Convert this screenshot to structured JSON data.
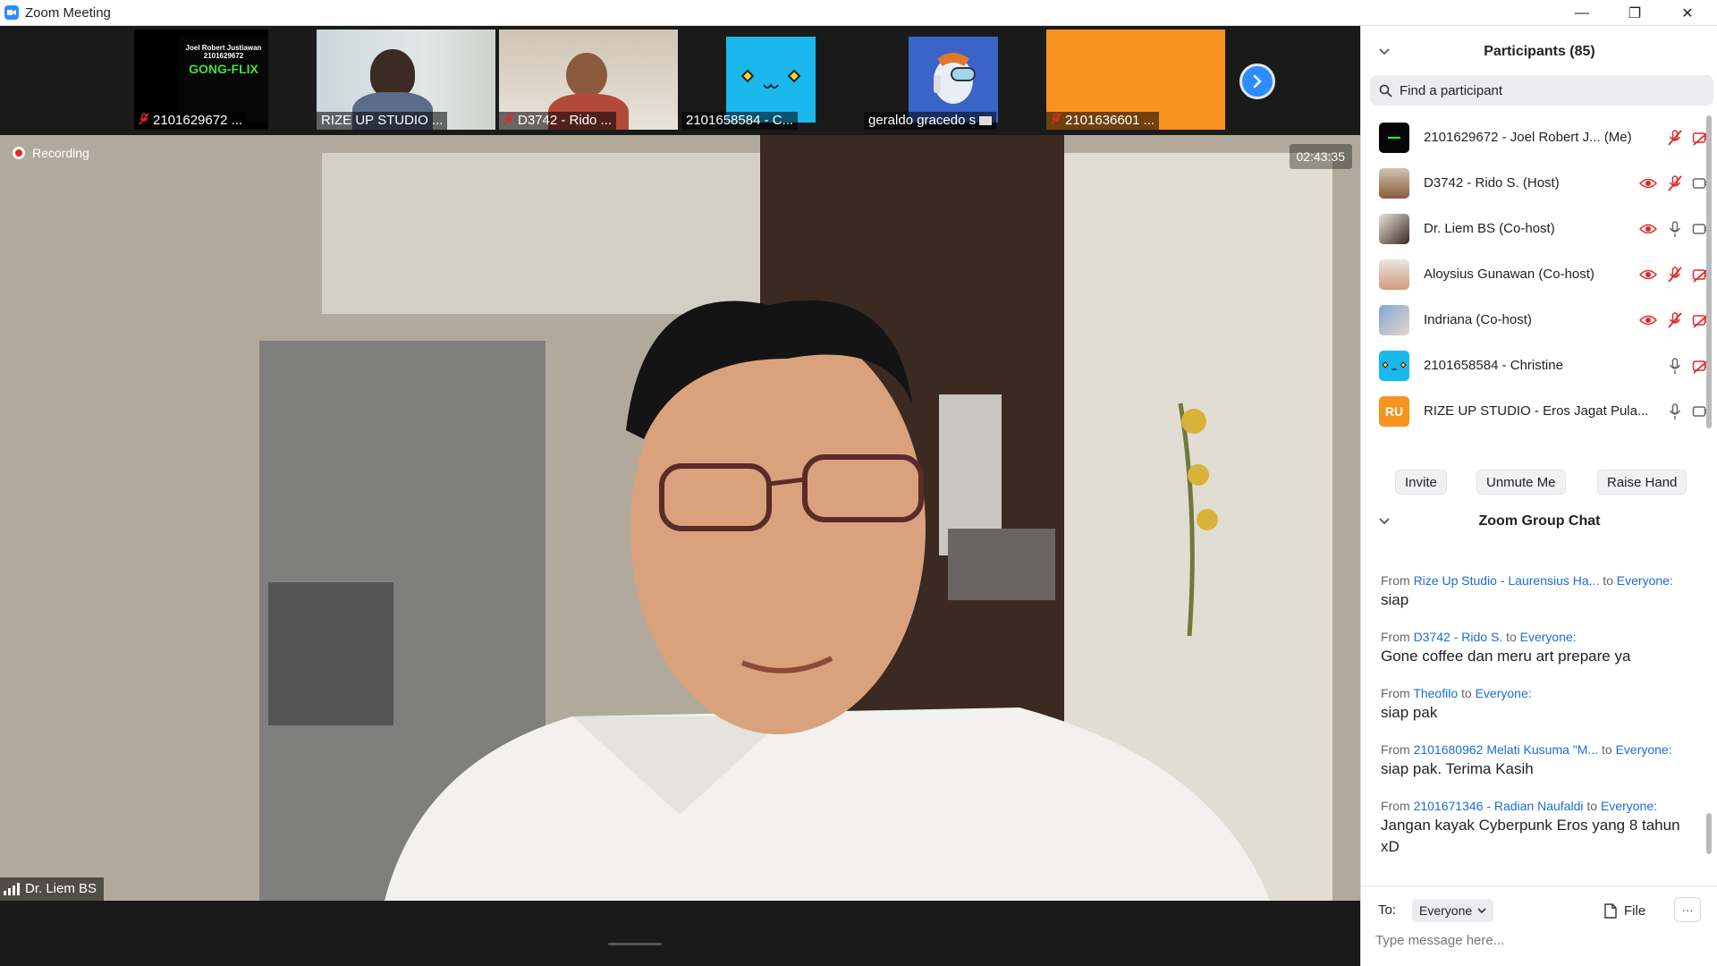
{
  "window": {
    "title": "Zoom Meeting",
    "minimize": "—",
    "restore": "❐",
    "close": "✕"
  },
  "thumbnails": [
    {
      "label": "2101629672 ...",
      "muted": true,
      "name_on_card": "Joel Robert Justiawan",
      "id_on_card": "2101629672",
      "brand_on_card": "GONG-FLIX"
    },
    {
      "label": "RIZE UP STUDIO ...",
      "muted": false
    },
    {
      "label": "D3742 - Rido ...",
      "muted": true
    },
    {
      "label": "2101658584 - C...",
      "muted": false
    },
    {
      "label": "geraldo gracedo s",
      "muted": false
    },
    {
      "label": "2101636601 ...",
      "muted": true
    }
  ],
  "main_video": {
    "recording_label": "Recording",
    "timer": "02:43:35",
    "speaker_name": "Dr. Liem BS"
  },
  "participants": {
    "header": "Participants (85)",
    "search_placeholder": "Find a participant",
    "list": [
      {
        "name": "2101629672 - Joel Robert J...",
        "suffix": "(Me)",
        "avatar": "image",
        "mic": "muted",
        "video": "off",
        "hand": false
      },
      {
        "name": "D3742 - Rido S. (Host)",
        "avatar": "image",
        "mic": "muted",
        "video": "on",
        "hand": true
      },
      {
        "name": "Dr. Liem BS (Co-host)",
        "avatar": "image",
        "mic": "on",
        "video": "on",
        "hand": true
      },
      {
        "name": "Aloysius Gunawan (Co-host)",
        "avatar": "image",
        "mic": "muted",
        "video": "off",
        "hand": true
      },
      {
        "name": "Indriana (Co-host)",
        "avatar": "image",
        "mic": "muted",
        "video": "off",
        "hand": true
      },
      {
        "name": "2101658584 - Christine",
        "avatar": "cat",
        "mic": "on",
        "video": "off",
        "hand": false
      },
      {
        "name": "RIZE UP STUDIO - Eros Jagat Pula...",
        "avatar": "initials",
        "initials": "RU",
        "mic": "on",
        "video": "on",
        "hand": false
      }
    ],
    "buttons": {
      "invite": "Invite",
      "unmute": "Unmute Me",
      "raise_hand": "Raise Hand"
    }
  },
  "chat": {
    "header": "Zoom Group Chat",
    "from_word": "From",
    "to_word": "to",
    "messages": [
      {
        "from": "Rize Up Studio - Laurensius Ha...",
        "to": "Everyone:",
        "text": "siap"
      },
      {
        "from": "D3742 - Rido S.",
        "to": "Everyone:",
        "text": "Gone coffee dan meru art prepare ya"
      },
      {
        "from": "Theofilo",
        "to": "Everyone:",
        "text": "siap pak"
      },
      {
        "from": "2101680962 Melati Kusuma \"M...",
        "to": "Everyone:",
        "text": "siap pak. Terima Kasih"
      },
      {
        "from": "2101671346 - Radian Naufaldi",
        "to": "Everyone:",
        "text": "Jangan kayak Cyberpunk Eros yang 8 tahun xD"
      }
    ],
    "to_label": "To:",
    "recipient": "Everyone",
    "file_label": "File",
    "more_label": "···",
    "input_placeholder": "Type message here..."
  },
  "colors": {
    "accent": "#2d8cff",
    "muted_red": "#e02828",
    "link_blue": "#1a6cd9",
    "rize_orange": "#f7931e"
  }
}
